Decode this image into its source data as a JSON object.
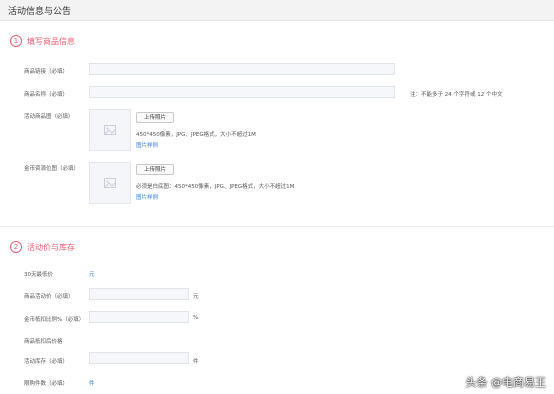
{
  "page": {
    "title": "活动信息与公告"
  },
  "section1": {
    "number": "1",
    "title": "填写商品信息",
    "fields": {
      "product_link_label": "商品链接（必填）",
      "product_name_label": "商品名称（必填）",
      "product_name_hint": "注：不能多于 24 个字符或 12 个中文",
      "activity_image_label": "活动商品图（必填）",
      "coin_image_label": "金币资源位图（必填）"
    },
    "upload": {
      "button_label": "上传照片",
      "activity_spec": "450*450像素，JPG、JPEG格式，大小不超过1M",
      "activity_example_link": "图片样例",
      "coin_spec": "必须是白底图：450*450像素，JPG、JPEG格式，大小不超过1M",
      "coin_example_link": "图片样例"
    }
  },
  "section2": {
    "number": "2",
    "title": "活动价与库存",
    "fields": {
      "lowest_price_label": "30天最低价",
      "lowest_price_value": "元",
      "activity_price_label": "商品活动价（必填）",
      "activity_price_unit": "元",
      "coin_deduct_label": "金币抵扣比例%（必填）",
      "coin_deduct_unit": "%",
      "after_deduct_label": "商品抵扣后价格",
      "stock_label": "活动库存（必填）",
      "stock_unit": "件",
      "limit_label": "限购件数（必填）",
      "limit_value": "件"
    }
  },
  "watermark": {
    "text": "头条 @电商易王"
  }
}
